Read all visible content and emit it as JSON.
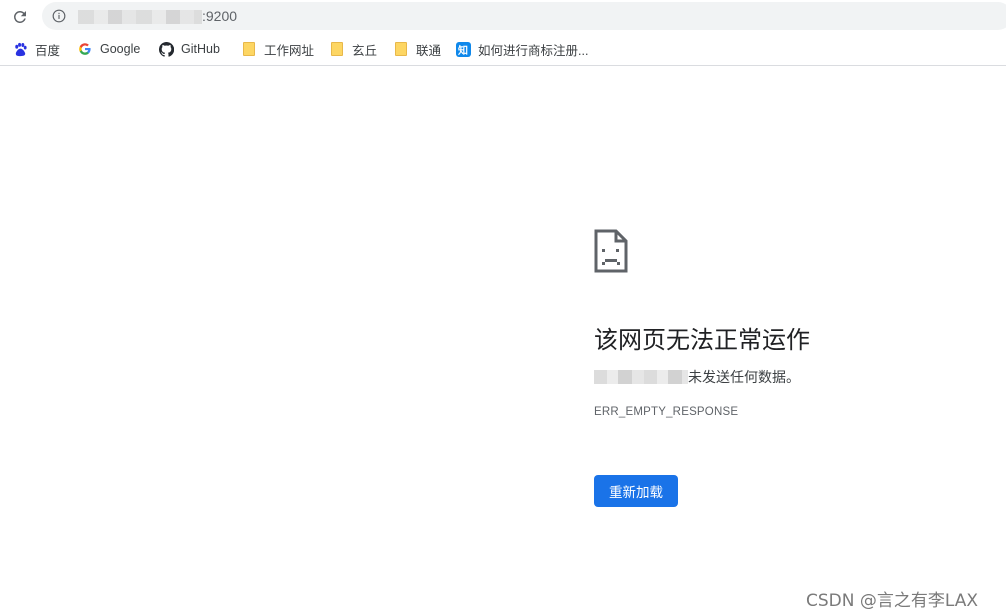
{
  "address_bar": {
    "url_visible_suffix": ":9200",
    "reload_icon": "reload-icon",
    "info_icon": "info-icon"
  },
  "bookmarks": [
    {
      "label": "百度",
      "icon": "baidu-paw-icon"
    },
    {
      "label": "Google",
      "icon": "google-g-icon"
    },
    {
      "label": "GitHub",
      "icon": "github-icon"
    },
    {
      "label": "工作网址",
      "icon": "folder-icon"
    },
    {
      "label": "玄丘",
      "icon": "folder-icon"
    },
    {
      "label": "联通",
      "icon": "folder-icon"
    },
    {
      "label": "如何进行商标注册...",
      "icon": "zhihu-icon",
      "icon_text": "知"
    }
  ],
  "error": {
    "icon": "sad-page-icon",
    "title": "该网页无法正常运作",
    "description_suffix": "未发送任何数据。",
    "code": "ERR_EMPTY_RESPONSE",
    "reload_button": "重新加载"
  },
  "colors": {
    "accent": "#1a73e8",
    "omnibox_bg": "#f1f3f4",
    "folder": "#fdd663"
  },
  "watermark": "CSDN @言之有李LAX"
}
